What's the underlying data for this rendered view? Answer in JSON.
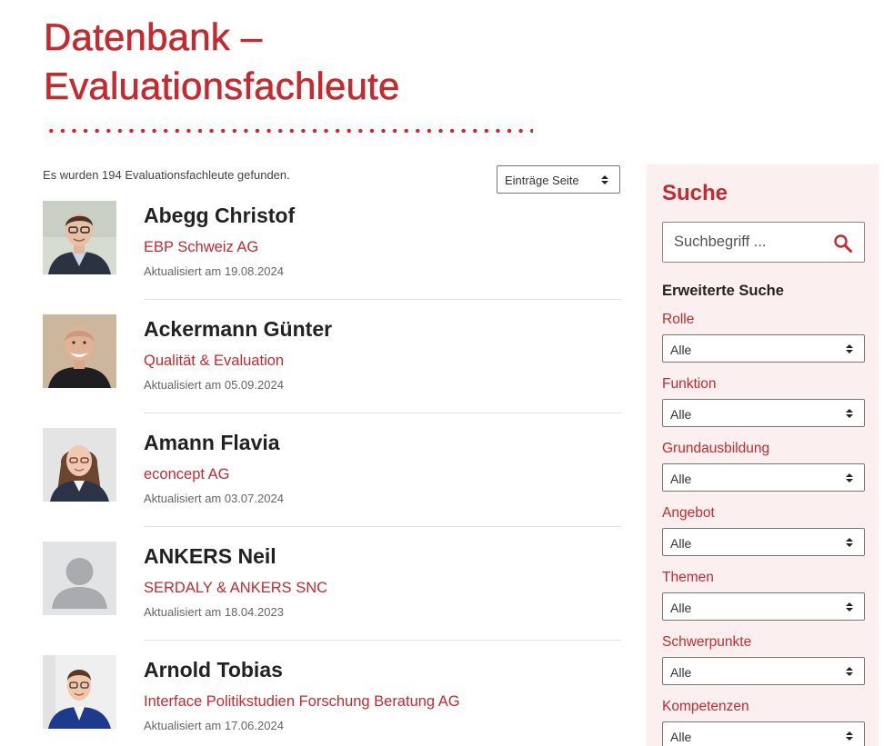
{
  "page": {
    "title_line1": "Datenbank –",
    "title_line2": "Evaluationsfachleute",
    "accent_color": "#c62a2f"
  },
  "results": {
    "count_text": "Es wurden 194 Evaluationsfachleute gefunden.",
    "per_page_label": "Einträge Seite"
  },
  "entries": [
    {
      "name": "Abegg Christof",
      "company": "EBP Schweiz AG",
      "updated": "Aktualisiert am 19.08.2024",
      "photo": "portrait-man-glasses"
    },
    {
      "name": "Ackermann Günter",
      "company": "Qualität & Evaluation",
      "updated": "Aktualisiert am 05.09.2024",
      "photo": "portrait-man-bald"
    },
    {
      "name": "Amann Flavia",
      "company": "econcept AG",
      "updated": "Aktualisiert am 03.07.2024",
      "photo": "portrait-woman-glasses"
    },
    {
      "name": "ANKERS Neil",
      "company": "SERDALY & ANKERS SNC",
      "updated": "Aktualisiert am 18.04.2023",
      "photo": "avatar-placeholder"
    },
    {
      "name": "Arnold Tobias",
      "company": "Interface Politikstudien Forschung Beratung AG",
      "updated": "Aktualisiert am 17.06.2024",
      "photo": "portrait-man-glasses-blue"
    }
  ],
  "sidebar": {
    "title": "Suche",
    "search_placeholder": "Suchbegriff ...",
    "search_icon": "search-icon",
    "advanced_title": "Erweiterte Suche",
    "filters": [
      {
        "label": "Rolle",
        "value": "Alle"
      },
      {
        "label": "Funktion",
        "value": "Alle"
      },
      {
        "label": "Grundausbildung",
        "value": "Alle"
      },
      {
        "label": "Angebot",
        "value": "Alle"
      },
      {
        "label": "Themen",
        "value": "Alle"
      },
      {
        "label": "Schwerpunkte",
        "value": "Alle"
      },
      {
        "label": "Kompetenzen",
        "value": "Alle"
      }
    ]
  }
}
